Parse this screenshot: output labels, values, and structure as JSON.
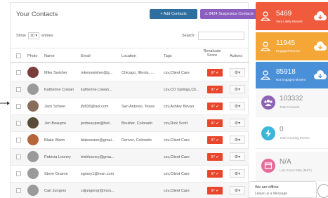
{
  "header": {
    "title": "Your Contacts",
    "add_label": "+ Add Contacts",
    "suspicious_label": "⚠ 8424 Suspicious Contacts"
  },
  "controls": {
    "show_label": "Show",
    "entries_value": "10",
    "entries_label": "entries",
    "search_label": "Search:"
  },
  "table": {
    "columns": [
      "Photo",
      "Name",
      "Email",
      "Location",
      "Tags",
      "Revaluate Score",
      "Actions"
    ],
    "rows": [
      {
        "name": "Mike Swisher",
        "email": "mkenswisher@g...",
        "location": "Chicago, Illinois, ...",
        "tags": "csv,Client Care",
        "score": "97 ✔",
        "avatar_color": "#7a3d3d"
      },
      {
        "name": "Katherine Cowan",
        "email": "katherine.cowan...",
        "location": "",
        "tags": "csv,CO Springs,Cli...",
        "score": "97 ✔",
        "avatar_color": "#9a9a9a"
      },
      {
        "name": "Jack Scheer",
        "email": "jfs830@aol.com",
        "location": "San Antonio, Texas",
        "tags": "csv,Ashley Bevan",
        "score": "97 ✔",
        "avatar_color": "#8a6c5a"
      },
      {
        "name": "Jen Beaupre",
        "email": "jenbeaupre@hot...",
        "location": "Boulder, Colorado",
        "tags": "csv,Rick Scott",
        "score": "97 ✔",
        "avatar_color": "#5a4a3a"
      },
      {
        "name": "Blake Wann",
        "email": "blakewann@gmai...",
        "location": "Denver, Colorado",
        "tags": "csv,Client Care",
        "score": "97 ✔",
        "avatar_color": "#b5653a"
      },
      {
        "name": "Patricia Looney",
        "email": "trishlooney@gma...",
        "location": "",
        "tags": "csv,Client Care",
        "score": "97 ✔",
        "avatar_color": "#9a9a9a"
      },
      {
        "name": "Steve Graeve",
        "email": "sgravy1@msn.com",
        "location": "",
        "tags": "csv,Client Care",
        "score": "97 ✔",
        "avatar_color": "#9a9a9a"
      },
      {
        "name": "Carl Jungers",
        "email": "cdjungersjr@msn...",
        "location": "",
        "tags": "csv,Client Care",
        "score": "97 ✔",
        "avatar_color": "#9a9a9a"
      }
    ]
  },
  "stats": {
    "likely_movers": {
      "value": "5469",
      "label": "Very Likely Movers",
      "color": "#ef5b3c"
    },
    "engaged_movers": {
      "value": "11945",
      "label": "Engaged Movers",
      "color": "#f4a636"
    },
    "not_engaged": {
      "value": "85918",
      "label": "Not Engaged Movers",
      "color": "#4a90d9"
    },
    "total_contacts": {
      "value": "103332",
      "label": "Total Contacts",
      "color": "#8e63b6"
    },
    "tracking_events": {
      "value": "0",
      "label": "Total Tracking Events",
      "color": "#3bb6d8"
    },
    "last_event": {
      "value": "N/A",
      "label": "Last Event Date (MST)",
      "color": "#e86a9a"
    }
  },
  "chat": {
    "status": "We are offline",
    "action": "Leave us a Message"
  }
}
